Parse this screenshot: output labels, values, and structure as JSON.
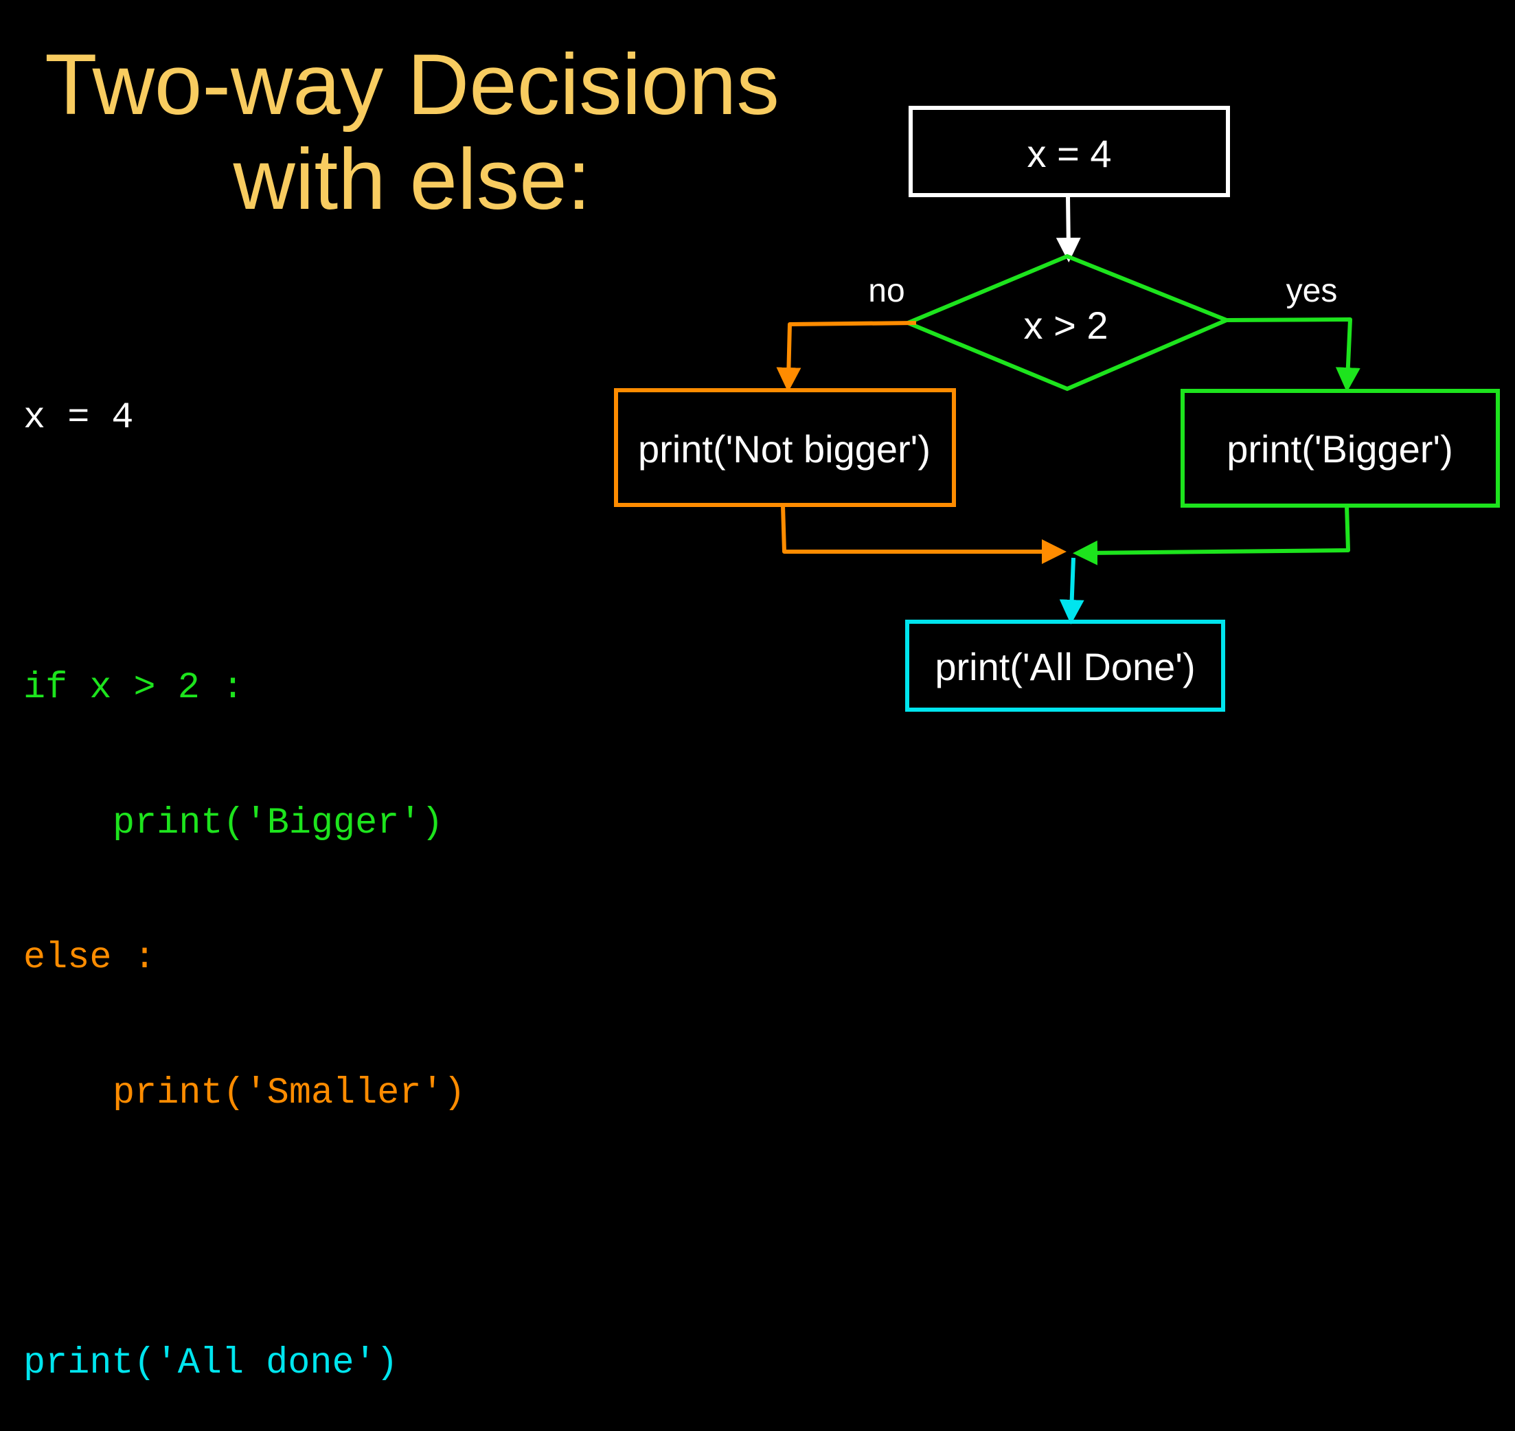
{
  "title": {
    "line1": "Two-way Decisions",
    "line2": "with else:"
  },
  "colors": {
    "background": "#000000",
    "title": "#f8cc60",
    "default_code": "#ffffff",
    "yes_branch": "#1de41d",
    "no_branch": "#ff8c00",
    "merge": "#00e5ee",
    "start_box": "#ffffff"
  },
  "code": {
    "line1": "x = 4",
    "line2": "if x > 2 :",
    "line3": "print('Bigger')",
    "line4": "else :",
    "line5": "print('Smaller')",
    "line6": "print('All done')"
  },
  "flowchart": {
    "start_node": "x = 4",
    "decision_node": "x > 2",
    "no_label": "no",
    "yes_label": "yes",
    "no_branch_node": "print('Not bigger')",
    "yes_branch_node": "print('Bigger')",
    "end_node": "print('All Done')"
  }
}
